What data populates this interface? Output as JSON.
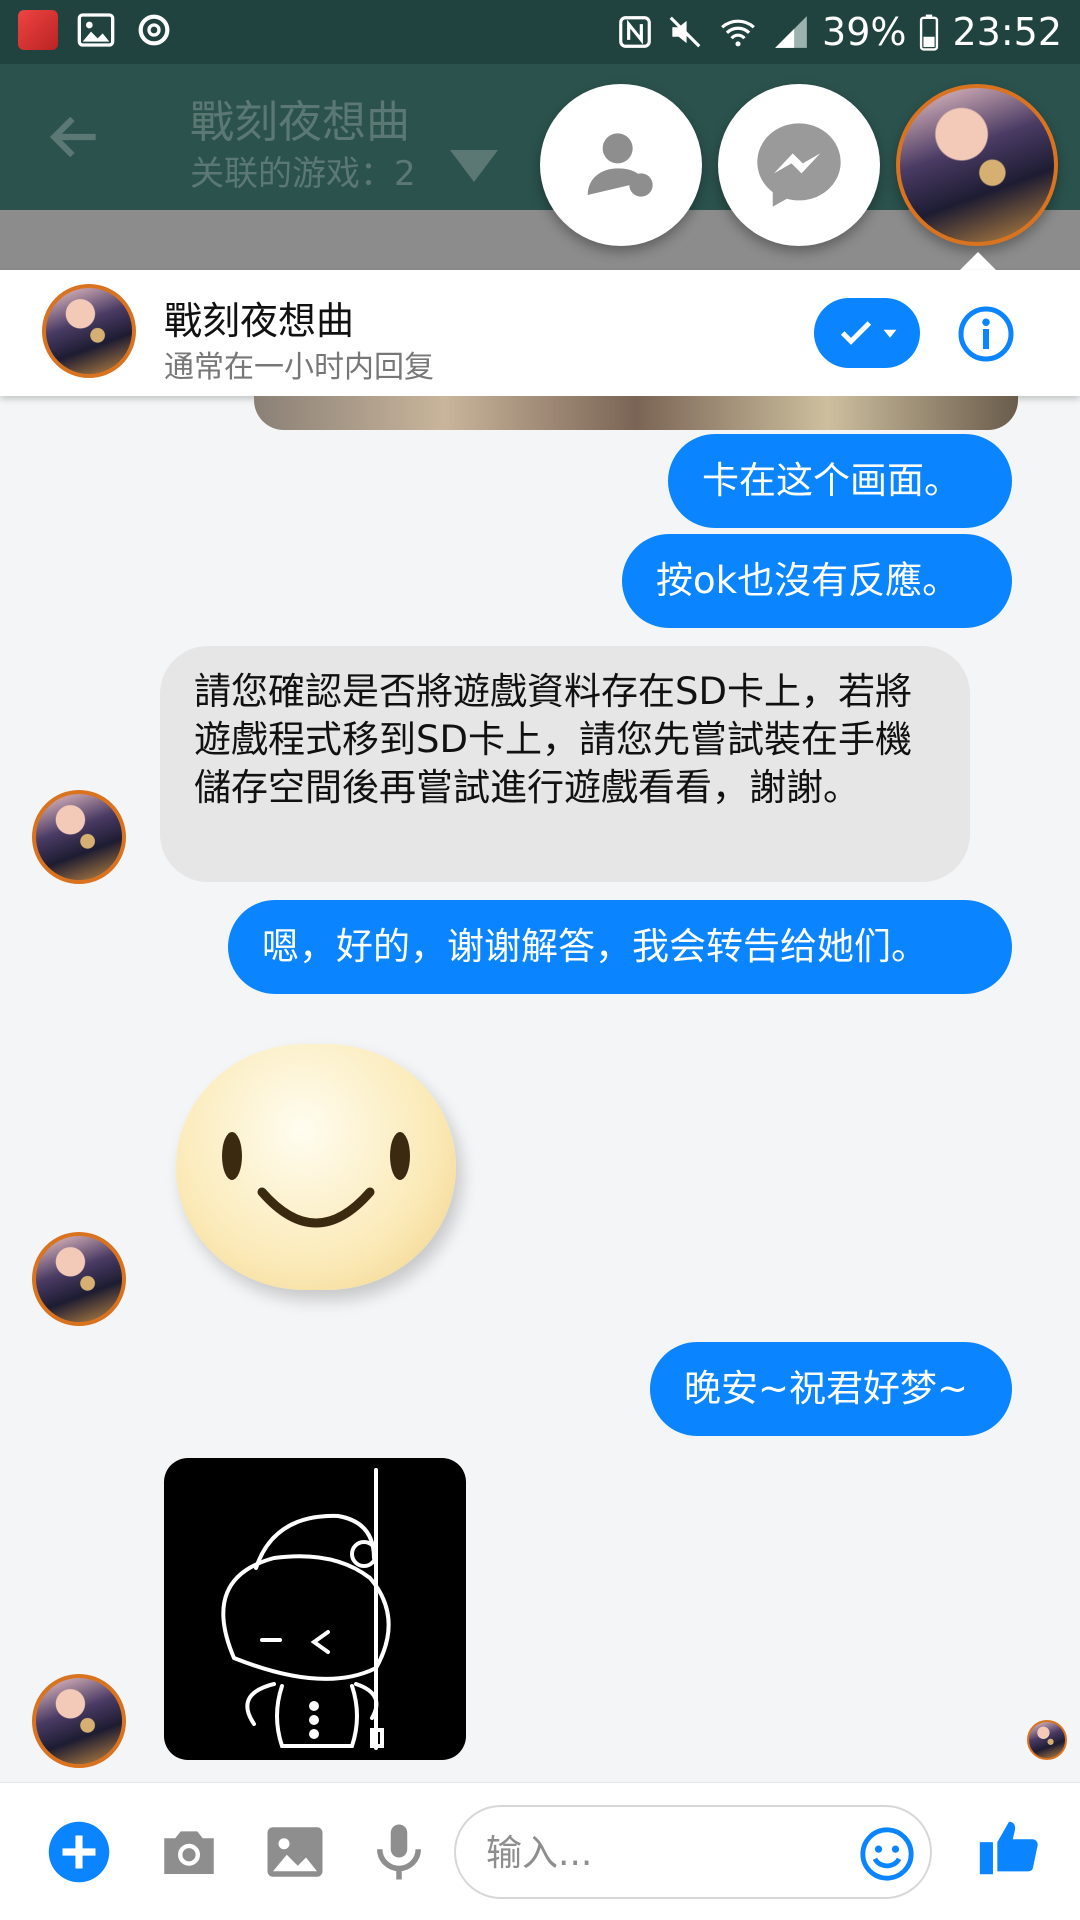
{
  "status_bar": {
    "battery": "39%",
    "time": "23:52"
  },
  "app_bar": {
    "title": "戰刻夜想曲",
    "subtitle": "关联的游戏：2"
  },
  "conversation": {
    "name": "戰刻夜想曲",
    "status": "通常在一小时内回复"
  },
  "messages": [
    {
      "from": "me",
      "text": "卡在这个画面。"
    },
    {
      "from": "me",
      "text": "按ok也沒有反應。"
    },
    {
      "from": "them",
      "text": "請您確認是否將遊戲資料存在SD卡上，若將遊戲程式移到SD卡上，請您先嘗試裝在手機儲存空間後再嘗試進行遊戲看看，謝謝。"
    },
    {
      "from": "me",
      "text": "嗯，好的，谢谢解答，我会转告给她们。"
    },
    {
      "from": "them",
      "type": "sticker",
      "icon": "smiley-sticker"
    },
    {
      "from": "me",
      "text": "晚安~祝君好梦~"
    },
    {
      "from": "them",
      "type": "sticker",
      "icon": "bun-character-sticker"
    }
  ],
  "composer": {
    "placeholder": "输入..."
  },
  "colors": {
    "messenger_blue": "#0a84ff",
    "status_bar": "#21433f",
    "app_bar": "#2b524d"
  }
}
